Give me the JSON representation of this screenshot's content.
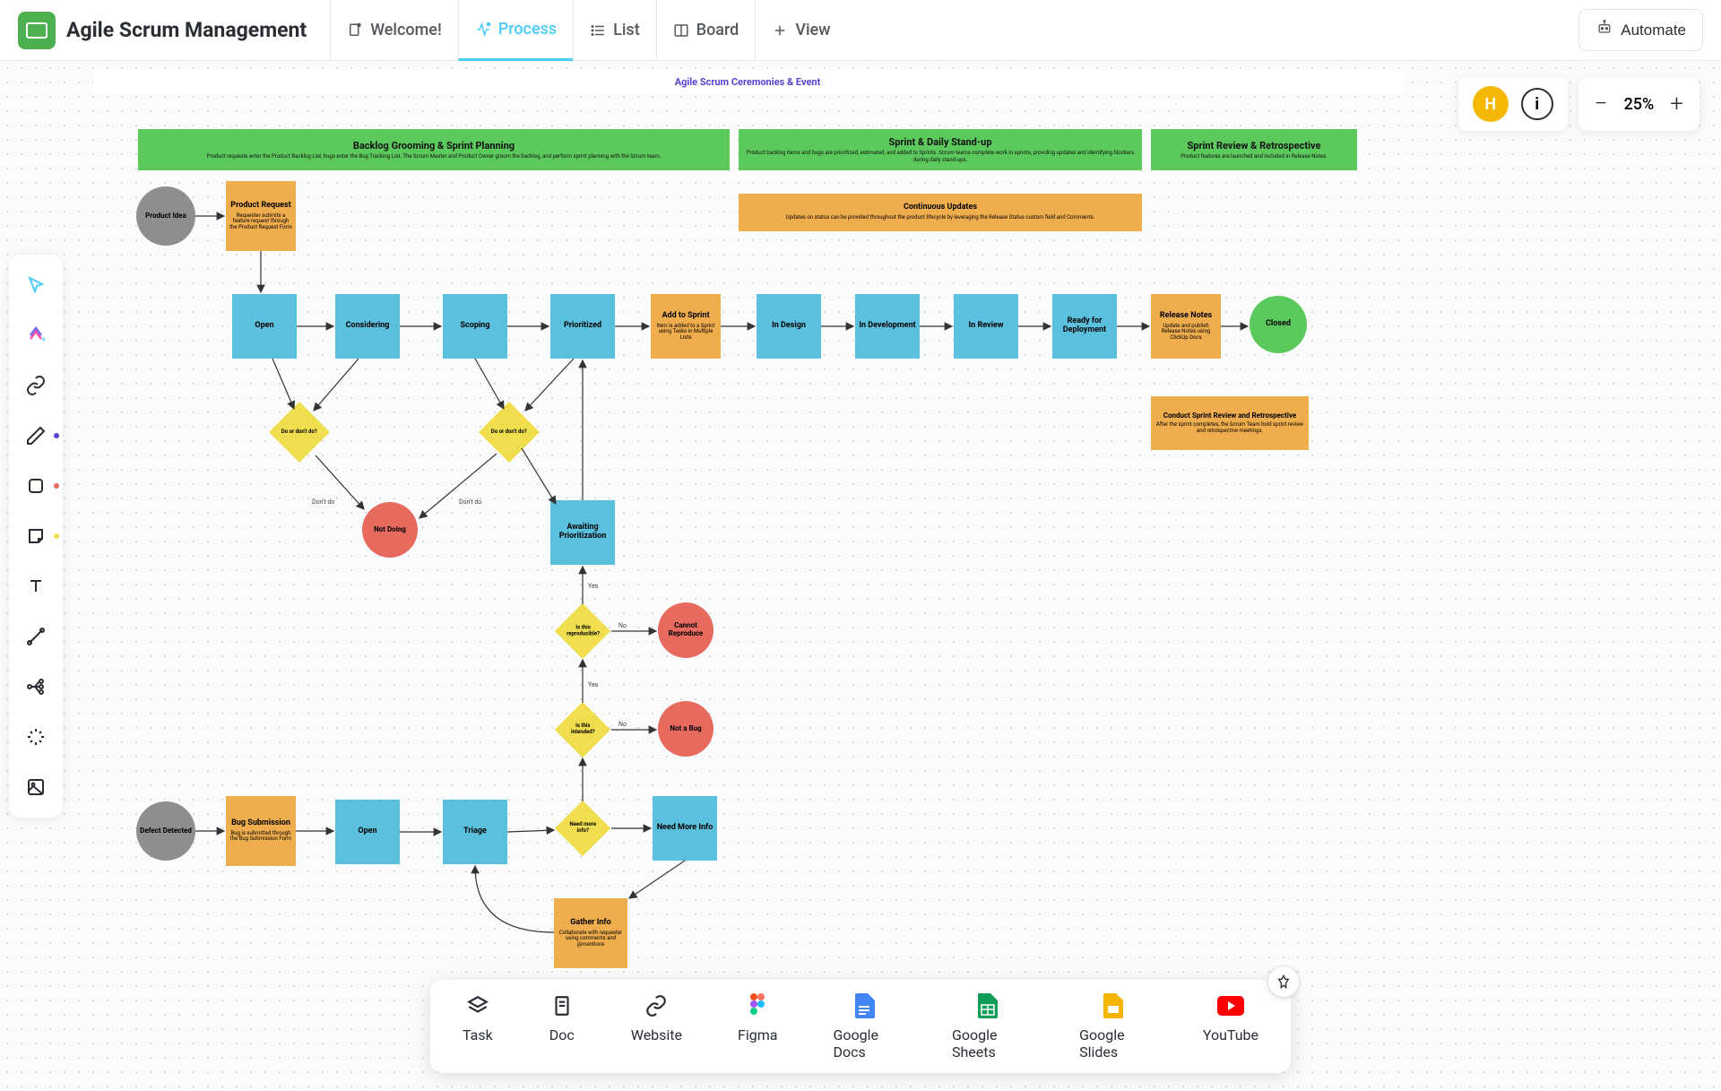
{
  "app": {
    "title": "Agile Scrum Management"
  },
  "tabs": {
    "welcome": "Welcome!",
    "process": "Process",
    "list": "List",
    "board": "Board",
    "addView": "View"
  },
  "automate": "Automate",
  "avatar": "H",
  "zoom": {
    "value": "25%"
  },
  "diagram": {
    "title": "Agile Scrum Ceremonies & Event",
    "phases": {
      "backlog": {
        "title": "Backlog Grooming & Sprint Planning",
        "sub": "Product requests enter the Product Backlog List, bugs enter the Bug Tracking List.\nThe Scrum Master and Product Owner groom the backlog, and perform sprint planning with the Scrum team."
      },
      "sprint": {
        "title": "Sprint & Daily Stand-up",
        "sub": "Product backlog items and bugs are prioritized, estimated, and added to Sprints. Scrum teams complete work in sprints, providing updates and identifying blockers during daily stand-ups."
      },
      "review": {
        "title": "Sprint Review & Retrospective",
        "sub": "Product features are launched and included in Release Notes."
      }
    },
    "nodes": {
      "productIdea": "Product Idea",
      "productRequest": {
        "title": "Product Request",
        "sub": "Requester submits a feature request through the Product Request Form"
      },
      "open": "Open",
      "considering": "Considering",
      "scoping": "Scoping",
      "prioritized": "Prioritized",
      "addToSprint": {
        "title": "Add to Sprint",
        "sub": "Item is added to a Sprint using Tasks in Multiple Lists"
      },
      "inDesign": "In Design",
      "inDevelopment": "In Development",
      "inReview": "In Review",
      "readyDeploy": "Ready for Deployment",
      "releaseNotes": {
        "title": "Release Notes",
        "sub": "Update and publish Release Notes using ClickUp Docs"
      },
      "closed": "Closed",
      "continuousUpdates": {
        "title": "Continuous Updates",
        "sub": "Updates on status can be provided throughout the product lifecycle by leveraging the Release Status custom field and Comments."
      },
      "retrospective": {
        "title": "Conduct Sprint Review and Retrospective",
        "sub": "After the sprint completes, the Scrum Team hold sprint review and retrospective meetings."
      },
      "decision1": "Do or don't do?",
      "decision2": "Do or don't do?",
      "notDoing": "Not Doing",
      "awaitingPrioritization": "Awaiting Prioritization",
      "reproducible": "Is this reproducible?",
      "cannotReproduce": "Cannot Reproduce",
      "intended": "Is this intended?",
      "notABug": "Not a Bug",
      "needMoreInfoQ": "Need more info?",
      "needMoreInfo": "Need More Info",
      "gatherInfo": {
        "title": "Gather Info",
        "sub": "Collaborate with requester using comments and @mentions"
      },
      "defectDetected": "Defect Detected",
      "bugSubmission": {
        "title": "Bug Submission",
        "sub": "Bug is submitted through the Bug Submission Form"
      },
      "open2": "Open",
      "triage": "Triage"
    },
    "edgeLabels": {
      "dontDo1": "Don't do",
      "dontDo2": "Don't do",
      "yes1": "Yes",
      "no1": "No",
      "yes2": "Yes",
      "no2": "No"
    }
  },
  "dock": {
    "task": "Task",
    "doc": "Doc",
    "website": "Website",
    "figma": "Figma",
    "gdocs": "Google Docs",
    "gsheets": "Google Sheets",
    "gslides": "Google Slides",
    "youtube": "YouTube"
  }
}
